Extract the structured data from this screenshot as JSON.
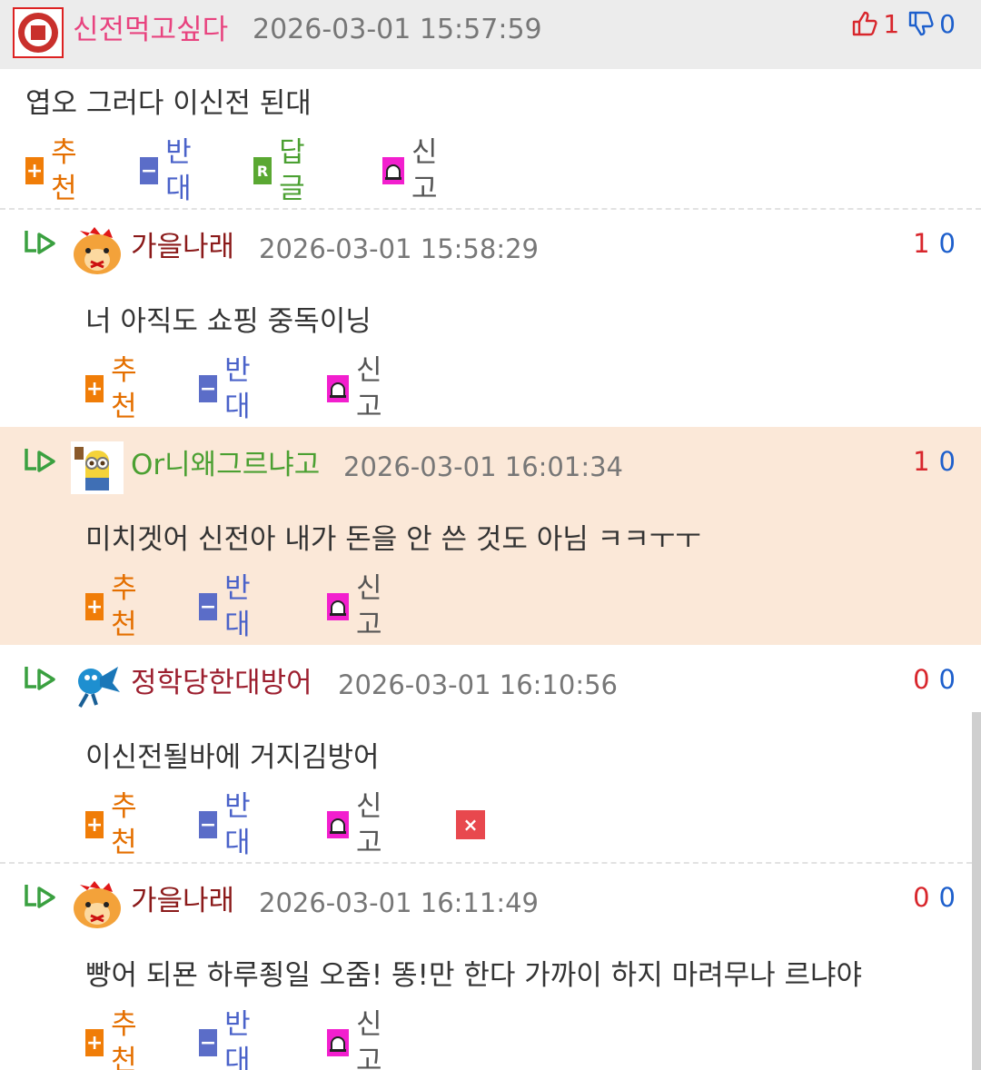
{
  "top_comment": {
    "nickname": "신전먹고싶다",
    "date": "2026-03-01 15:57:59",
    "thumbs_up": "1",
    "thumbs_down": "0",
    "body": "엽오 그러다 이신전 된대",
    "actions": {
      "recommend": "추천",
      "oppose": "반대",
      "reply": "답글",
      "report": "신고",
      "reply_icon": "R"
    }
  },
  "replies": [
    {
      "nickname": "가을나래",
      "nick_color": "#8b1a1a",
      "date": "2026-03-01 15:58:29",
      "up": "1",
      "down": "0",
      "body": "너 아직도 쇼핑 중독이닝"
    },
    {
      "nickname": "Or니왜그르냐고",
      "nick_color": "#4ba032",
      "date": "2026-03-01 16:01:34",
      "up": "1",
      "down": "0",
      "body": "미치겟어 신전아 내가 돈을 안 쓴 것도 아님 ㅋㅋㅜㅜ"
    },
    {
      "nickname": "정학당한대방어",
      "nick_color": "#9c1f2f",
      "date": "2026-03-01 16:10:56",
      "up": "0",
      "down": "0",
      "body": "이신전될바에 거지김방어"
    },
    {
      "nickname": "가을나래",
      "nick_color": "#8b1a1a",
      "date": "2026-03-01 16:11:49",
      "up": "0",
      "down": "0",
      "body": "빵어 되묜 하루죙일 오줌! 똥!만 한다 가까이 하지 마려무나 르냐야"
    }
  ],
  "reply_actions": {
    "recommend": "추천",
    "oppose": "반대",
    "report": "신고"
  },
  "icons": {
    "plus": "+",
    "minus": "−",
    "delete": "×"
  },
  "colors": {
    "recommend": "#f07d08",
    "oppose": "#5b6dc8",
    "reply": "#5aa832",
    "report": "#f21fce",
    "delete": "#e8484e",
    "highlight": "#fbe8d8"
  }
}
